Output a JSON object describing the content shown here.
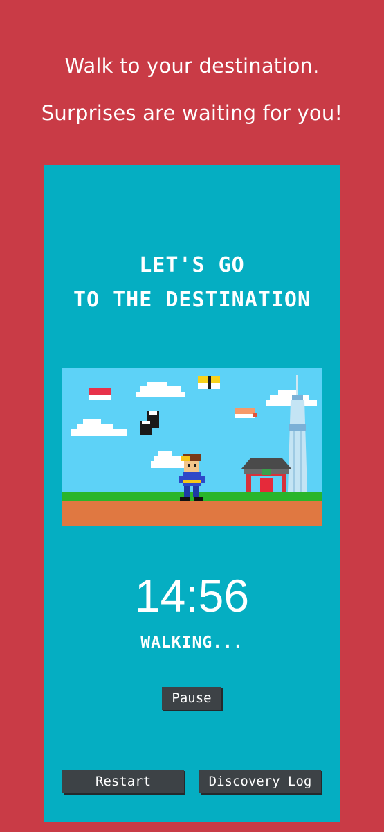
{
  "header": {
    "line1": "Walk to your destination.",
    "line2": "Surprises are waiting for you!"
  },
  "game": {
    "headline_line1": "LET'S GO",
    "headline_line2": "TO THE DESTINATION",
    "timer": "14:56",
    "status": "WALKING...",
    "pause_label": "Pause",
    "restart_label": "Restart",
    "discovery_label": "Discovery Log"
  },
  "colors": {
    "page_background": "#c93b46",
    "panel_background": "#05aec2",
    "sky": "#5dd2f7",
    "grass": "#2ab52a",
    "ground": "#e07841",
    "button": "#3d4246"
  }
}
